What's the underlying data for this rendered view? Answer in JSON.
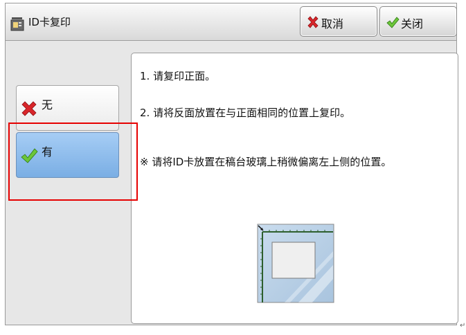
{
  "header": {
    "title": "ID卡复印",
    "cancel_label": "取消",
    "close_label": "关闭"
  },
  "options": [
    {
      "label": "无",
      "icon": "x-icon",
      "selected": false
    },
    {
      "label": "有",
      "icon": "check-icon",
      "selected": true
    }
  ],
  "instructions": {
    "line1": "1. 请复印正面。",
    "line2": "2. 请将反面放置在与正面相同的位置上复印。",
    "note": "※ 请将ID卡放置在稿台玻璃上稍微偏离左上侧的位置。"
  },
  "colors": {
    "selected_option": "#8bbcee",
    "highlight_box": "#e60000",
    "check_green": "#5cb82e",
    "x_red": "#d9262b"
  }
}
